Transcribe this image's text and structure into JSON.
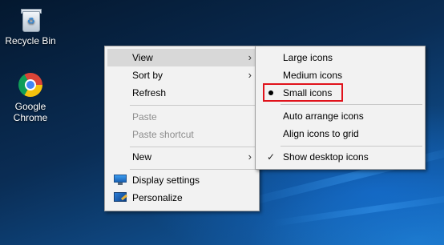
{
  "desktop": {
    "icons": [
      {
        "label": "Recycle Bin",
        "icon": "recycle-bin-icon"
      },
      {
        "label": "Google\nChrome",
        "label_line1": "Google",
        "label_line2": "Chrome",
        "icon": "chrome-icon"
      }
    ]
  },
  "context_menu": {
    "items": [
      {
        "label": "View",
        "has_submenu": true,
        "highlighted": true
      },
      {
        "label": "Sort by",
        "has_submenu": true
      },
      {
        "label": "Refresh"
      },
      {
        "label": "Paste",
        "disabled": true
      },
      {
        "label": "Paste shortcut",
        "disabled": true
      },
      {
        "label": "New",
        "has_submenu": true
      },
      {
        "label": "Display settings",
        "icon": "display-settings-icon"
      },
      {
        "label": "Personalize",
        "icon": "personalize-icon"
      }
    ],
    "arrow_glyph": "›"
  },
  "view_submenu": {
    "items": [
      {
        "label": "Large icons"
      },
      {
        "label": "Medium icons"
      },
      {
        "label": "Small icons",
        "selected": true,
        "annotated": true
      },
      {
        "label": "Auto arrange icons"
      },
      {
        "label": "Align icons to grid"
      },
      {
        "label": "Show desktop icons",
        "checked": true
      }
    ],
    "check_glyph": "✓"
  },
  "colors": {
    "menu_bg": "#f2f2f2",
    "highlight": "#d8d8d8",
    "annotation_box": "#e0121b",
    "disabled_text": "#8d8d8d"
  }
}
